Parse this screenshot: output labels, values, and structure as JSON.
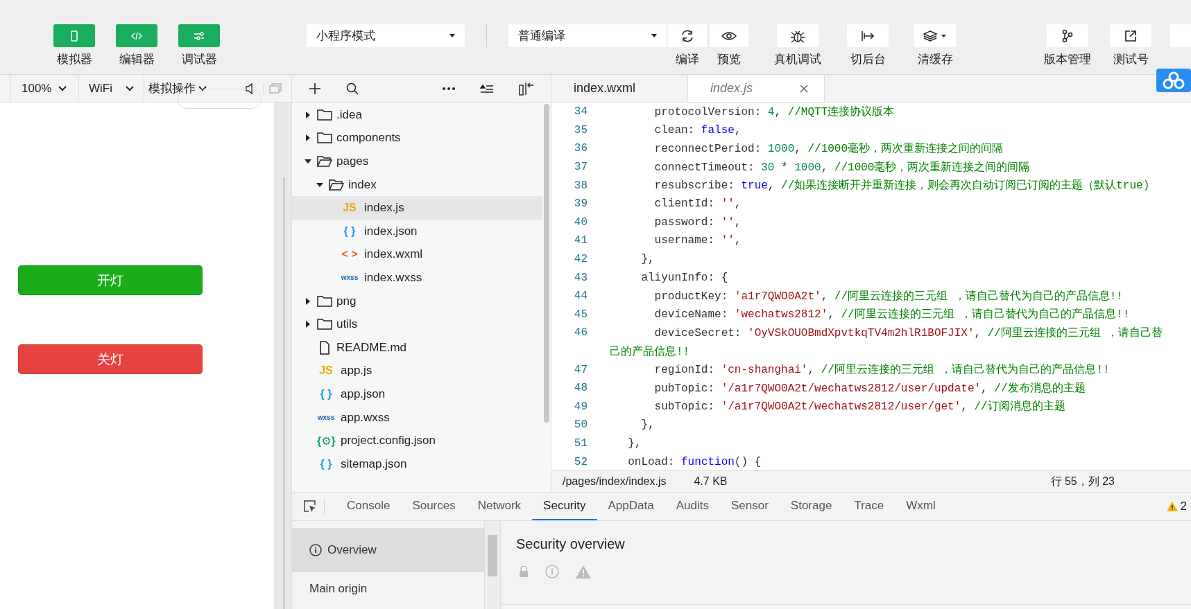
{
  "toolbar": {
    "view_buttons": [
      {
        "label": "模拟器",
        "selected": true
      },
      {
        "label": "编辑器",
        "selected": true
      },
      {
        "label": "调试器",
        "selected": true
      }
    ],
    "mode_select": {
      "value": "小程序模式"
    },
    "compile_select": {
      "value": "普通编译"
    },
    "actions": [
      {
        "label": "编译"
      },
      {
        "label": "预览"
      },
      {
        "label": "真机调试"
      },
      {
        "label": "切后台"
      },
      {
        "label": "清缓存"
      }
    ],
    "right_actions": [
      {
        "label": "版本管理"
      },
      {
        "label": "测试号"
      }
    ]
  },
  "simulator": {
    "zoom": "100%",
    "network": "WiFi",
    "operation": "模拟操作",
    "buttons": [
      {
        "label": "开灯",
        "color": "#1aad19"
      },
      {
        "label": "关灯",
        "color": "#e64340"
      }
    ]
  },
  "file_tree": [
    {
      "name": ".idea",
      "kind": "folder",
      "expanded": false,
      "selected": false
    },
    {
      "name": "components",
      "kind": "folder",
      "expanded": false,
      "selected": false
    },
    {
      "name": "pages",
      "kind": "folder",
      "expanded": true,
      "selected": false,
      "children": [
        {
          "name": "index",
          "kind": "folder",
          "expanded": true,
          "selected": false,
          "children": [
            {
              "name": "index.js",
              "kind": "js",
              "icon": "JS",
              "selected": true
            },
            {
              "name": "index.json",
              "kind": "json",
              "icon": "{ }",
              "selected": false
            },
            {
              "name": "index.wxml",
              "kind": "wxml",
              "icon": "< >",
              "selected": false
            },
            {
              "name": "index.wxss",
              "kind": "wxss",
              "icon": "wxss",
              "selected": false
            }
          ]
        }
      ]
    },
    {
      "name": "png",
      "kind": "folder",
      "expanded": false,
      "selected": false
    },
    {
      "name": "utils",
      "kind": "folder",
      "expanded": false,
      "selected": false
    },
    {
      "name": "README.md",
      "kind": "file",
      "selected": false
    },
    {
      "name": "app.js",
      "kind": "js",
      "icon": "JS",
      "selected": false
    },
    {
      "name": "app.json",
      "kind": "json",
      "icon": "{ }",
      "selected": false
    },
    {
      "name": "app.wxss",
      "kind": "wxss",
      "icon": "wxss",
      "selected": false
    },
    {
      "name": "project.config.json",
      "kind": "config",
      "icon": "{⚙}",
      "selected": false
    },
    {
      "name": "sitemap.json",
      "kind": "json",
      "icon": "{ }",
      "selected": false
    }
  ],
  "editor": {
    "tabs": [
      {
        "label": "index.wxml",
        "selected": false,
        "preview": false
      },
      {
        "label": "index.js",
        "selected": true,
        "preview": true
      }
    ],
    "lines": [
      {
        "number": "34",
        "segments": [
          {
            "kind": "key",
            "text": "      protocolVersion: "
          },
          {
            "kind": "num",
            "text": "4"
          },
          {
            "kind": "key",
            "text": ", "
          },
          {
            "kind": "comment",
            "text": "//MQTT连接协议版本"
          }
        ]
      },
      {
        "number": "35",
        "segments": [
          {
            "kind": "key",
            "text": "      clean: "
          },
          {
            "kind": "kw",
            "text": "false"
          },
          {
            "kind": "key",
            "text": ","
          }
        ]
      },
      {
        "number": "36",
        "segments": [
          {
            "kind": "key",
            "text": "      reconnectPeriod: "
          },
          {
            "kind": "num",
            "text": "1000"
          },
          {
            "kind": "key",
            "text": ", "
          },
          {
            "kind": "comment",
            "text": "//1000毫秒，两次重新连接之间的间隔"
          }
        ]
      },
      {
        "number": "37",
        "segments": [
          {
            "kind": "key",
            "text": "      connectTimeout: "
          },
          {
            "kind": "num",
            "text": "30"
          },
          {
            "kind": "key",
            "text": " * "
          },
          {
            "kind": "num",
            "text": "1000"
          },
          {
            "kind": "key",
            "text": ", "
          },
          {
            "kind": "comment",
            "text": "//1000毫秒，两次重新连接之间的间隔"
          }
        ]
      },
      {
        "number": "38",
        "segments": [
          {
            "kind": "key",
            "text": "      resubscribe: "
          },
          {
            "kind": "kw",
            "text": "true"
          },
          {
            "kind": "key",
            "text": ", "
          },
          {
            "kind": "comment",
            "text": "//如果连接断开并重新连接，则会再次自动订阅已订阅的主题（默认true)"
          }
        ]
      },
      {
        "number": "39",
        "segments": [
          {
            "kind": "key",
            "text": "      clientId: "
          },
          {
            "kind": "str",
            "text": "''"
          },
          {
            "kind": "key",
            "text": ","
          }
        ]
      },
      {
        "number": "40",
        "segments": [
          {
            "kind": "key",
            "text": "      password: "
          },
          {
            "kind": "str",
            "text": "''"
          },
          {
            "kind": "key",
            "text": ","
          }
        ]
      },
      {
        "number": "41",
        "segments": [
          {
            "kind": "key",
            "text": "      username: "
          },
          {
            "kind": "str",
            "text": "''"
          },
          {
            "kind": "key",
            "text": ","
          }
        ]
      },
      {
        "number": "42",
        "segments": [
          {
            "kind": "key",
            "text": "    },"
          }
        ]
      },
      {
        "number": "43",
        "segments": [
          {
            "kind": "key",
            "text": "    aliyunInfo: {"
          }
        ]
      },
      {
        "number": "44",
        "segments": [
          {
            "kind": "key",
            "text": "      productKey: "
          },
          {
            "kind": "str",
            "text": "'a1r7QWO0A2t'"
          },
          {
            "kind": "key",
            "text": ", "
          },
          {
            "kind": "comment",
            "text": "//阿里云连接的三元组 ，请自己替代为自己的产品信息!!"
          }
        ]
      },
      {
        "number": "45",
        "segments": [
          {
            "kind": "key",
            "text": "      deviceName: "
          },
          {
            "kind": "str",
            "text": "'wechatws2812'"
          },
          {
            "kind": "key",
            "text": ", "
          },
          {
            "kind": "comment",
            "text": "//阿里云连接的三元组 ，请自己替代为自己的产品信息!!"
          }
        ]
      },
      {
        "number": "46",
        "segments": [
          {
            "kind": "key",
            "text": "      deviceSecret: "
          },
          {
            "kind": "str",
            "text": "'OyVSkOUOBmdXpvtkqTV4m2hlR1BOFJIX'"
          },
          {
            "kind": "key",
            "text": ", "
          },
          {
            "kind": "comment",
            "text": "//阿里云连接的三元组 ，请自己替"
          }
        ]
      },
      {
        "segments": [
          {
            "kind": "comment",
            "text": "己的产品信息!!"
          }
        ]
      },
      {
        "number": "47",
        "segments": [
          {
            "kind": "key",
            "text": "      regionId: "
          },
          {
            "kind": "str",
            "text": "'cn-shanghai'"
          },
          {
            "kind": "key",
            "text": ", "
          },
          {
            "kind": "comment",
            "text": "//阿里云连接的三元组 ，请自己替代为自己的产品信息!!"
          }
        ]
      },
      {
        "number": "48",
        "segments": [
          {
            "kind": "key",
            "text": "      pubTopic: "
          },
          {
            "kind": "str",
            "text": "'/a1r7QWO0A2t/wechatws2812/user/update'"
          },
          {
            "kind": "key",
            "text": ", "
          },
          {
            "kind": "comment",
            "text": "//发布消息的主题"
          }
        ]
      },
      {
        "number": "49",
        "segments": [
          {
            "kind": "key",
            "text": "      subTopic: "
          },
          {
            "kind": "str",
            "text": "'/a1r7QWO0A2t/wechatws2812/user/get'"
          },
          {
            "kind": "key",
            "text": ", "
          },
          {
            "kind": "comment",
            "text": "//订阅消息的主题"
          }
        ]
      },
      {
        "number": "50",
        "segments": [
          {
            "kind": "key",
            "text": "    },"
          }
        ]
      },
      {
        "number": "51",
        "segments": [
          {
            "kind": "key",
            "text": "  },"
          }
        ]
      },
      {
        "number": "52",
        "segments": [
          {
            "kind": "key",
            "text": "  onLoad: "
          },
          {
            "kind": "kw",
            "text": "function"
          },
          {
            "kind": "key",
            "text": "() {"
          }
        ]
      }
    ],
    "status_bar": {
      "path": "/pages/index/index.js",
      "size": "4.7 KB",
      "cursor": "行 55，列 23"
    }
  },
  "devtools": {
    "tabs": [
      {
        "label": "Console",
        "selected": false
      },
      {
        "label": "Sources",
        "selected": false
      },
      {
        "label": "Network",
        "selected": false
      },
      {
        "label": "Security",
        "selected": true
      },
      {
        "label": "AppData",
        "selected": false
      },
      {
        "label": "Audits",
        "selected": false
      },
      {
        "label": "Sensor",
        "selected": false
      },
      {
        "label": "Storage",
        "selected": false
      },
      {
        "label": "Trace",
        "selected": false
      },
      {
        "label": "Wxml",
        "selected": false
      }
    ],
    "warning_count": "2",
    "sidebar": [
      {
        "label": "Overview",
        "selected": true
      },
      {
        "label": "Main origin",
        "selected": false
      }
    ],
    "title": "Security overview"
  }
}
